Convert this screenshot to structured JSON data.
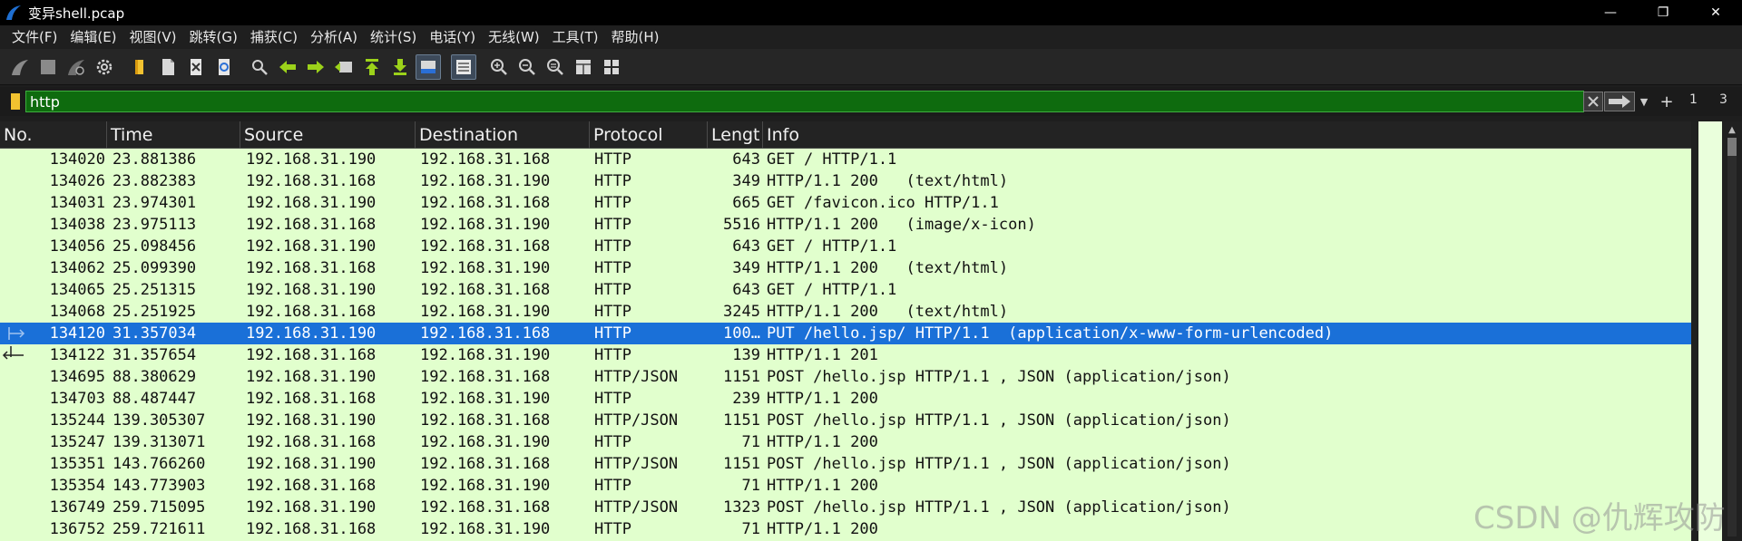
{
  "window": {
    "title": "变异shell.pcap",
    "minimize": "—",
    "maximize": "❐",
    "close": "✕"
  },
  "menu": [
    "文件(F)",
    "编辑(E)",
    "视图(V)",
    "跳转(G)",
    "捕获(C)",
    "分析(A)",
    "统计(S)",
    "电话(Y)",
    "无线(W)",
    "工具(T)",
    "帮助(H)"
  ],
  "filter": {
    "value": "http",
    "count_a": "1",
    "count_b": "3"
  },
  "columns": [
    "No.",
    "Time",
    "Source",
    "Destination",
    "Protocol",
    "Lengt",
    "Info"
  ],
  "packets": [
    {
      "no": "134020",
      "time": "23.881386",
      "src": "192.168.31.190",
      "dst": "192.168.31.168",
      "proto": "HTTP",
      "len": "643",
      "info": "GET / HTTP/1.1"
    },
    {
      "no": "134026",
      "time": "23.882383",
      "src": "192.168.31.168",
      "dst": "192.168.31.190",
      "proto": "HTTP",
      "len": "349",
      "info": "HTTP/1.1 200   (text/html)"
    },
    {
      "no": "134031",
      "time": "23.974301",
      "src": "192.168.31.190",
      "dst": "192.168.31.168",
      "proto": "HTTP",
      "len": "665",
      "info": "GET /favicon.ico HTTP/1.1"
    },
    {
      "no": "134038",
      "time": "23.975113",
      "src": "192.168.31.168",
      "dst": "192.168.31.190",
      "proto": "HTTP",
      "len": "5516",
      "info": "HTTP/1.1 200   (image/x-icon)"
    },
    {
      "no": "134056",
      "time": "25.098456",
      "src": "192.168.31.190",
      "dst": "192.168.31.168",
      "proto": "HTTP",
      "len": "643",
      "info": "GET / HTTP/1.1"
    },
    {
      "no": "134062",
      "time": "25.099390",
      "src": "192.168.31.168",
      "dst": "192.168.31.190",
      "proto": "HTTP",
      "len": "349",
      "info": "HTTP/1.1 200   (text/html)"
    },
    {
      "no": "134065",
      "time": "25.251315",
      "src": "192.168.31.190",
      "dst": "192.168.31.168",
      "proto": "HTTP",
      "len": "643",
      "info": "GET / HTTP/1.1"
    },
    {
      "no": "134068",
      "time": "25.251925",
      "src": "192.168.31.168",
      "dst": "192.168.31.190",
      "proto": "HTTP",
      "len": "3245",
      "info": "HTTP/1.1 200   (text/html)"
    },
    {
      "no": "134120",
      "time": "31.357034",
      "src": "192.168.31.190",
      "dst": "192.168.31.168",
      "proto": "HTTP",
      "len": "100…",
      "info": "PUT /hello.jsp/ HTTP/1.1  (application/x-www-form-urlencoded)",
      "selected": true,
      "mark": "request"
    },
    {
      "no": "134122",
      "time": "31.357654",
      "src": "192.168.31.168",
      "dst": "192.168.31.190",
      "proto": "HTTP",
      "len": "139",
      "info": "HTTP/1.1 201",
      "mark": "response"
    },
    {
      "no": "134695",
      "time": "88.380629",
      "src": "192.168.31.190",
      "dst": "192.168.31.168",
      "proto": "HTTP/JSON",
      "len": "1151",
      "info": "POST /hello.jsp HTTP/1.1 , JSON (application/json)"
    },
    {
      "no": "134703",
      "time": "88.487447",
      "src": "192.168.31.168",
      "dst": "192.168.31.190",
      "proto": "HTTP",
      "len": "239",
      "info": "HTTP/1.1 200"
    },
    {
      "no": "135244",
      "time": "139.305307",
      "src": "192.168.31.190",
      "dst": "192.168.31.168",
      "proto": "HTTP/JSON",
      "len": "1151",
      "info": "POST /hello.jsp HTTP/1.1 , JSON (application/json)"
    },
    {
      "no": "135247",
      "time": "139.313071",
      "src": "192.168.31.168",
      "dst": "192.168.31.190",
      "proto": "HTTP",
      "len": "71",
      "info": "HTTP/1.1 200"
    },
    {
      "no": "135351",
      "time": "143.766260",
      "src": "192.168.31.190",
      "dst": "192.168.31.168",
      "proto": "HTTP/JSON",
      "len": "1151",
      "info": "POST /hello.jsp HTTP/1.1 , JSON (application/json)"
    },
    {
      "no": "135354",
      "time": "143.773903",
      "src": "192.168.31.168",
      "dst": "192.168.31.190",
      "proto": "HTTP",
      "len": "71",
      "info": "HTTP/1.1 200"
    },
    {
      "no": "136749",
      "time": "259.715095",
      "src": "192.168.31.190",
      "dst": "192.168.31.168",
      "proto": "HTTP/JSON",
      "len": "1323",
      "info": "POST /hello.jsp HTTP/1.1 , JSON (application/json)"
    },
    {
      "no": "136752",
      "time": "259.721611",
      "src": "192.168.31.168",
      "dst": "192.168.31.190",
      "proto": "HTTP",
      "len": "71",
      "info": "HTTP/1.1 200"
    }
  ],
  "colors": {
    "row_bg": "#e1ffcd",
    "selected_bg": "#1a70d8",
    "filter_bg": "#0e6b0e"
  },
  "watermark": "CSDN @仇辉攻防"
}
